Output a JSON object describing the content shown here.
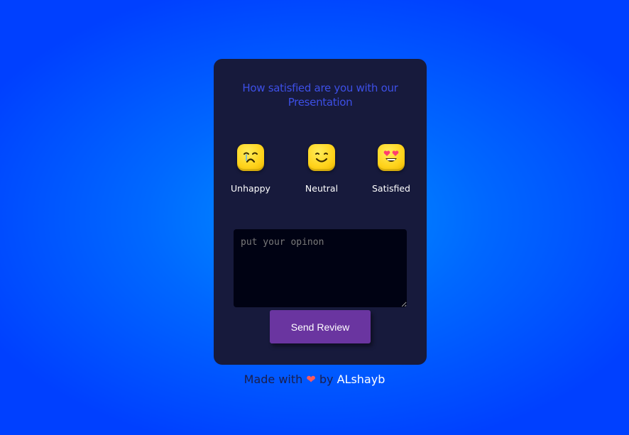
{
  "card": {
    "question": "How satisfied are you with our Presentation",
    "ratings": [
      {
        "label": "Unhappy",
        "icon": "sad-face-icon"
      },
      {
        "label": "Neutral",
        "icon": "smiling-face-icon"
      },
      {
        "label": "Satisfied",
        "icon": "heart-eyes-face-icon"
      }
    ],
    "opinion": {
      "placeholder": "put your opinon",
      "value": ""
    },
    "send_label": "Send Review"
  },
  "footer": {
    "made_with": "Made with",
    "heart": "❤",
    "by": "by",
    "author": "ALshayb"
  },
  "colors": {
    "card_bg": "#171a3c",
    "question": "#3d4fe6",
    "button": "#6a35a0",
    "emoji": "#ffd21a"
  }
}
